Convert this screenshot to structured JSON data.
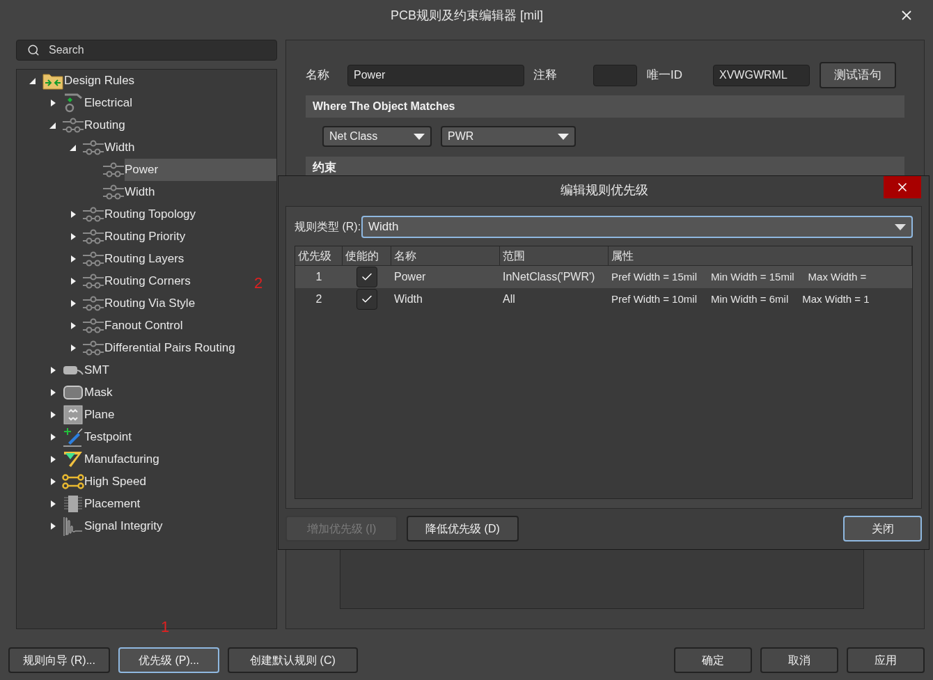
{
  "window": {
    "title": "PCB规则及约束编辑器 [mil]"
  },
  "search": {
    "placeholder": "Search"
  },
  "tree": [
    {
      "label": "Design Rules",
      "kind": "folder",
      "expanded": true,
      "selected": false,
      "children": [
        {
          "label": "Electrical",
          "kind": "electrical",
          "expanded": false,
          "selected": false
        },
        {
          "label": "Routing",
          "kind": "routing",
          "expanded": true,
          "selected": false,
          "children": [
            {
              "label": "Width",
              "kind": "routing",
              "expanded": true,
              "selected": false,
              "children": [
                {
                  "label": "Power",
                  "kind": "routing",
                  "selected": true
                },
                {
                  "label": "Width",
                  "kind": "routing",
                  "selected": false
                }
              ]
            },
            {
              "label": "Routing Topology",
              "kind": "routing",
              "expanded": false,
              "selected": false
            },
            {
              "label": "Routing Priority",
              "kind": "routing",
              "expanded": false,
              "selected": false
            },
            {
              "label": "Routing Layers",
              "kind": "routing",
              "expanded": false,
              "selected": false
            },
            {
              "label": "Routing Corners",
              "kind": "routing",
              "expanded": false,
              "selected": false
            },
            {
              "label": "Routing Via Style",
              "kind": "routing",
              "expanded": false,
              "selected": false
            },
            {
              "label": "Fanout Control",
              "kind": "routing",
              "expanded": false,
              "selected": false
            },
            {
              "label": "Differential Pairs Routing",
              "kind": "routing",
              "expanded": false,
              "selected": false
            }
          ]
        },
        {
          "label": "SMT",
          "kind": "smt",
          "expanded": false,
          "selected": false
        },
        {
          "label": "Mask",
          "kind": "mask",
          "expanded": false,
          "selected": false
        },
        {
          "label": "Plane",
          "kind": "plane",
          "expanded": false,
          "selected": false
        },
        {
          "label": "Testpoint",
          "kind": "testpoint",
          "expanded": false,
          "selected": false
        },
        {
          "label": "Manufacturing",
          "kind": "manufacturing",
          "expanded": false,
          "selected": false
        },
        {
          "label": "High Speed",
          "kind": "highspeed",
          "expanded": false,
          "selected": false
        },
        {
          "label": "Placement",
          "kind": "placement",
          "expanded": false,
          "selected": false
        },
        {
          "label": "Signal Integrity",
          "kind": "signal",
          "expanded": false,
          "selected": false
        }
      ]
    }
  ],
  "rule": {
    "name_label": "名称",
    "name": "Power",
    "comment_label": "注释",
    "id_label": "唯一ID",
    "id": "XVWGWRML",
    "test_button": "测试语句",
    "match_title": "Where The Object Matches",
    "match_kind": "Net Class",
    "match_value": "PWR",
    "constraints_title": "约束"
  },
  "annotations": [
    {
      "text": "2",
      "kind": "tree"
    },
    {
      "text": "1",
      "kind": "bottom"
    }
  ],
  "bottom_left_buttons": [
    {
      "label": "规则向导 (R)...",
      "focused": false
    },
    {
      "label": "优先级 (P)...",
      "focused": true
    },
    {
      "label": "创建默认规则 (C)",
      "focused": false
    }
  ],
  "bottom_right_buttons": [
    {
      "label": "确定",
      "focused": false
    },
    {
      "label": "取消",
      "focused": false
    },
    {
      "label": "应用",
      "focused": false
    }
  ],
  "dialog": {
    "title": "编辑规则优先级",
    "rule_type_label": "规则类型 (R):",
    "rule_type": "Width",
    "columns": [
      "优先级",
      "使能的",
      "名称",
      "范围",
      "属性"
    ],
    "rows": [
      {
        "priority": "1",
        "enabled": true,
        "name": "Power",
        "scope": "InNetClass('PWR')",
        "selected": true,
        "properties": [
          "Pref Width = 15mil",
          "Min Width = 15mil",
          "Max Width ="
        ]
      },
      {
        "priority": "2",
        "enabled": true,
        "name": "Width",
        "scope": "All",
        "selected": false,
        "properties": [
          "Pref Width = 10mil",
          "Min Width = 6mil",
          "Max Width = 1"
        ]
      }
    ],
    "left_buttons": [
      {
        "label": "增加优先级 (I)",
        "disabled": true,
        "focused": false
      },
      {
        "label": "降低优先级 (D)",
        "disabled": false,
        "focused": false
      }
    ],
    "right_buttons": [
      {
        "label": "关闭",
        "disabled": false,
        "focused": true
      }
    ]
  }
}
